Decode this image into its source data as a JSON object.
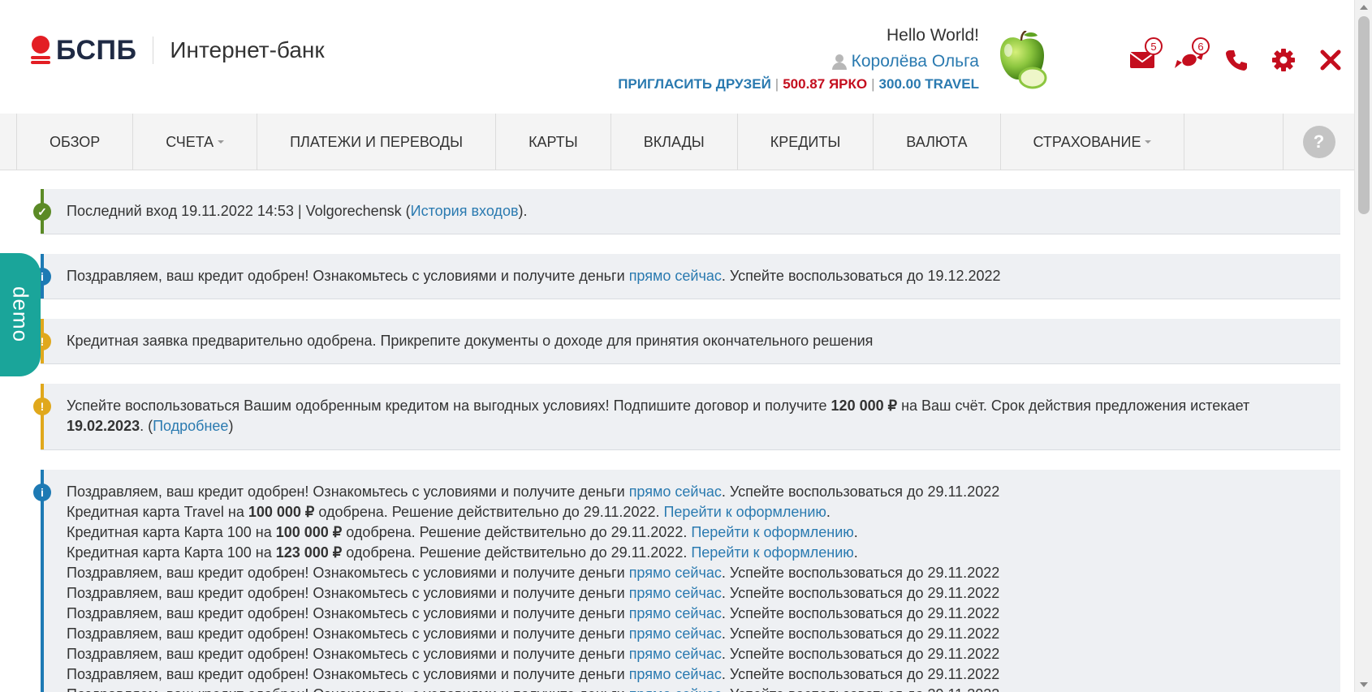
{
  "header": {
    "logo_text": "БСПБ",
    "logo_sub": "Интернет-банк",
    "greeting": "Hello World!",
    "user_name": "Королёва Ольга",
    "invite_label": "ПРИГЛАСИТЬ ДРУЗЕЙ",
    "yarko_balance": "500.87 ЯРКО",
    "travel_balance": "300.00 TRAVEL",
    "separator": "|",
    "messages_count": "5",
    "offers_count": "6",
    "colors": {
      "brand_red": "#e31e24",
      "link_blue": "#2a7ab0",
      "accent_red": "#c40e1e"
    }
  },
  "nav": {
    "items": [
      {
        "label": "ОБЗОР"
      },
      {
        "label": "СЧЕТА"
      },
      {
        "label": "ПЛАТЕЖИ И ПЕРЕВОДЫ"
      },
      {
        "label": "КАРТЫ"
      },
      {
        "label": "ВКЛАДЫ"
      },
      {
        "label": "КРЕДИТЫ"
      },
      {
        "label": "ВАЛЮТА"
      },
      {
        "label": "СТРАХОВАНИЕ"
      }
    ],
    "help_label": "?"
  },
  "demo_label": "demo",
  "alerts": {
    "last_login": {
      "prefix": "Последний вход 19.11.2022 14:53 | Volgorechensk (",
      "link": "История входов",
      "suffix": ")."
    },
    "credit_approved": {
      "prefix": "Поздравляем, ваш кредит одобрен! Ознакомьтесь с условиями и получите деньги ",
      "link": "прямо сейчас",
      "suffix": ". Успейте воспользоваться до 19.12.2022"
    },
    "preapproved": {
      "text": "Кредитная заявка предварительно одобрена. Прикрепите документы о доходе для принятия окончательного решения"
    },
    "offer": {
      "prefix": "Успейте воспользоваться Вашим одобренным кредитом на выгодных условиях! Подпишите договор и получите ",
      "amount": "120 000 ₽",
      "middle": " на Ваш счёт. Срок действия предложения истекает ",
      "date": "19.02.2023",
      "after_date": ". (",
      "link": "Подробнее",
      "close": ")"
    },
    "list": {
      "credit_prefix": "Поздравляем, ваш кредит одобрен! Ознакомьтесь с условиями и получите деньги ",
      "credit_link": "прямо сейчас",
      "credit_suffix": ". Успейте воспользоваться до 29.11.2022",
      "card1_prefix": "Кредитная карта Travel на ",
      "card1_amount": "100 000 ₽",
      "card_mid": " одобрена. Решение действительно до 29.11.2022. ",
      "card_link": "Перейти к оформлению",
      "card_end": ".",
      "card2_prefix": "Кредитная карта Карта 100 на ",
      "card2_amount": "100 000 ₽",
      "card3_prefix": "Кредитная карта Карта 100 на ",
      "card3_amount": "123 000 ₽"
    }
  }
}
